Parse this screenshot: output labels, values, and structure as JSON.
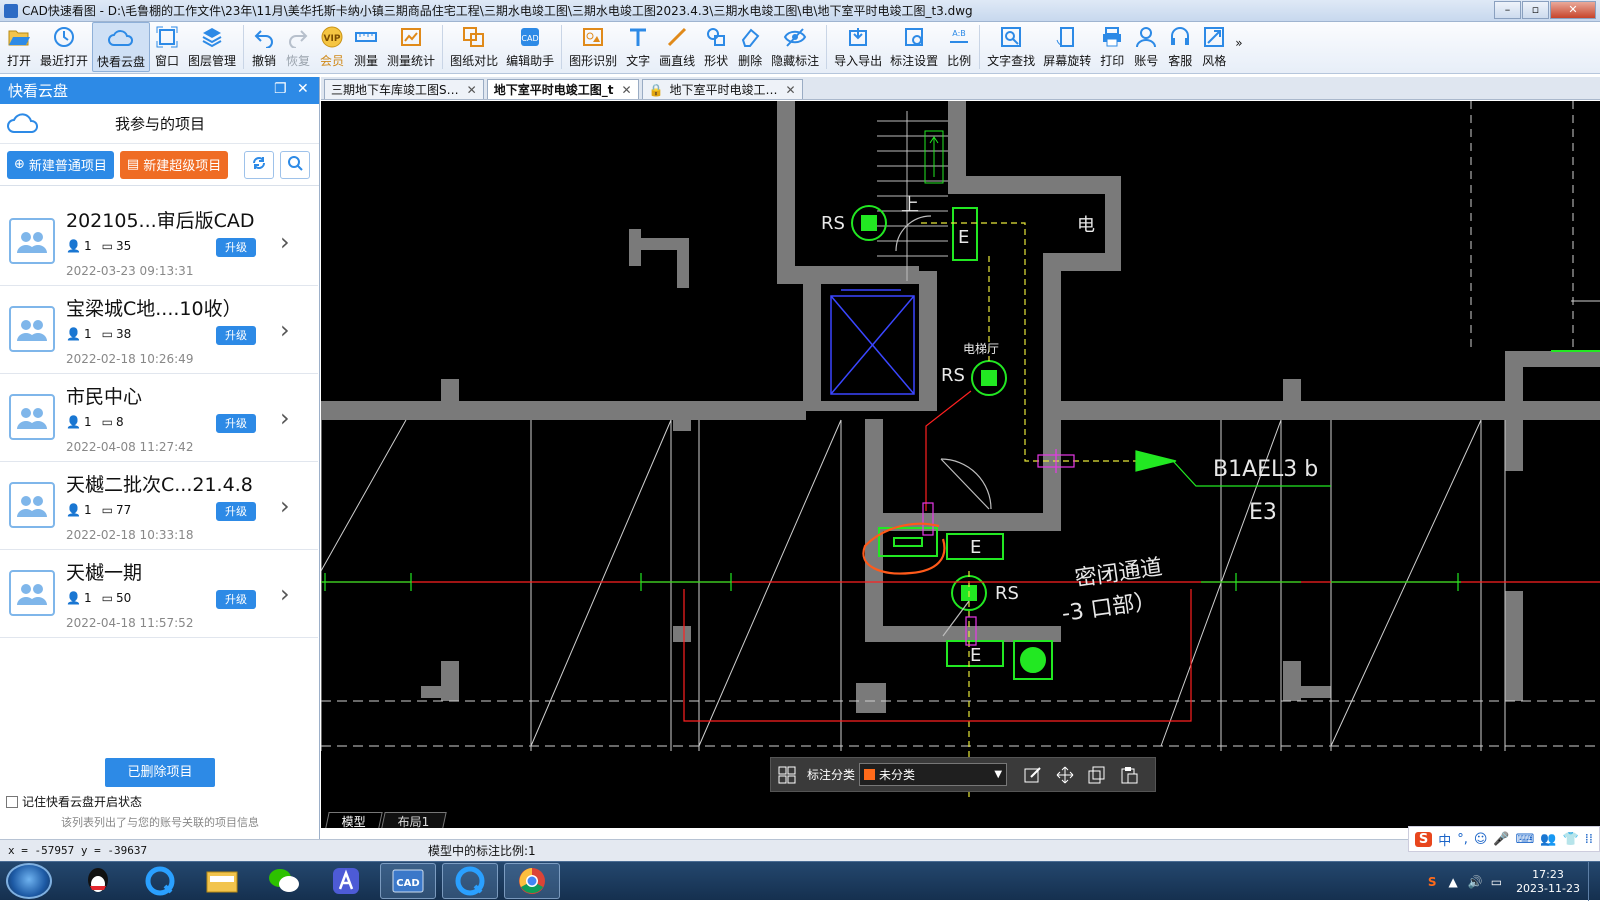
{
  "window": {
    "title": "CAD快速看图 - D:\\毛鲁棚的工作文件\\23年\\11月\\美华托斯卡纳小镇三期商品住宅工程\\三期水电竣工图\\三期水电竣工图2023.4.3\\三期水电竣工图\\电\\地下室平时电竣工图_t3.dwg",
    "controls": [
      "–",
      "▫",
      "✕"
    ]
  },
  "toolbar": [
    {
      "label": "打开",
      "icon": "folder-open-icon"
    },
    {
      "label": "最近打开",
      "icon": "clock-icon"
    },
    {
      "label": "快看云盘",
      "icon": "cloud-icon",
      "active": true
    },
    {
      "label": "窗口",
      "icon": "window-icon"
    },
    {
      "label": "图层管理",
      "icon": "layers-icon"
    },
    {
      "label": "撤销",
      "icon": "undo-icon"
    },
    {
      "label": "恢复",
      "icon": "redo-icon",
      "disabled": true
    },
    {
      "label": "会员",
      "icon": "vip-icon"
    },
    {
      "label": "测量",
      "icon": "ruler-icon"
    },
    {
      "label": "测量统计",
      "icon": "measure-stats-icon"
    },
    {
      "label": "图纸对比",
      "icon": "compare-icon"
    },
    {
      "label": "编辑助手",
      "icon": "edit-assistant-icon"
    },
    {
      "label": "图形识别",
      "icon": "shape-recognize-icon"
    },
    {
      "label": "文字",
      "icon": "text-icon"
    },
    {
      "label": "画直线",
      "icon": "line-icon"
    },
    {
      "label": "形状",
      "icon": "shape-icon"
    },
    {
      "label": "删除",
      "icon": "eraser-icon"
    },
    {
      "label": "隐藏标注",
      "icon": "eye-hide-icon"
    },
    {
      "label": "导入导出",
      "icon": "import-export-icon"
    },
    {
      "label": "标注设置",
      "icon": "annotation-settings-icon"
    },
    {
      "label": "比例",
      "icon": "scale-icon"
    },
    {
      "label": "文字查找",
      "icon": "text-search-icon"
    },
    {
      "label": "屏幕旋转",
      "icon": "rotate-screen-icon"
    },
    {
      "label": "打印",
      "icon": "printer-icon"
    },
    {
      "label": "账号",
      "icon": "user-icon"
    },
    {
      "label": "客服",
      "icon": "headset-icon"
    },
    {
      "label": "风格",
      "icon": "style-icon"
    }
  ],
  "toolbar_more": "»",
  "sidebar": {
    "header": "快看云盘",
    "section_title": "我参与的项目",
    "new_normal": "新建普通项目",
    "new_super": "新建超级项目",
    "projects": [
      {
        "name": "202105...审后版CAD",
        "members": "1",
        "files": "35",
        "upgrade": "升级",
        "date": "2022-03-23 09:13:31"
      },
      {
        "name": "宝梁城C地....10收）",
        "members": "1",
        "files": "38",
        "upgrade": "升级",
        "date": "2022-02-18 10:26:49"
      },
      {
        "name": "市民中心",
        "members": "1",
        "files": "8",
        "upgrade": "升级",
        "date": "2022-04-08 11:27:42"
      },
      {
        "name": "天樾二批次C...21.4.8",
        "members": "1",
        "files": "77",
        "upgrade": "升级",
        "date": "2022-02-18 10:33:18"
      },
      {
        "name": "天樾一期",
        "members": "1",
        "files": "50",
        "upgrade": "升级",
        "date": "2022-04-18 11:57:52"
      }
    ],
    "deleted_button": "已删除项目",
    "remember_label": "记住快看云盘开启状态",
    "hint": "该列表列出了与您的账号关联的项目信息"
  },
  "doc_tabs": [
    {
      "label": "三期地下车库竣工图S…",
      "active": false
    },
    {
      "label": "地下室平时电竣工图_t",
      "active": true
    },
    {
      "label": "地下室平时电竣工…",
      "active": false,
      "locked": true
    }
  ],
  "drawing": {
    "labels": {
      "rs1": "RS",
      "rs2": "RS",
      "rs3": "RS",
      "e1": "E",
      "e2": "E",
      "e3": "E",
      "up": "上",
      "elec": "电",
      "elevator_hall": "电梯厅",
      "circuit": "B1AEL3 b",
      "circuit2": "E3",
      "passage1": "密闭通道",
      "passage2": "-3 口部）"
    }
  },
  "annotation_bar": {
    "label": "标注分类",
    "selected": "未分类",
    "swatch": "#ff6a1a"
  },
  "layout_tabs": [
    "模型",
    "布局1"
  ],
  "status": {
    "coords": "x = -57957  y = -39637",
    "scale": "模型中的标注比例:1"
  },
  "ime": [
    "S",
    "中",
    "°,",
    "☺",
    "🎤",
    "⌨",
    "👥",
    "👕",
    "⁞⁞"
  ],
  "clock": {
    "time": "17:23",
    "date": "2023-11-23"
  }
}
